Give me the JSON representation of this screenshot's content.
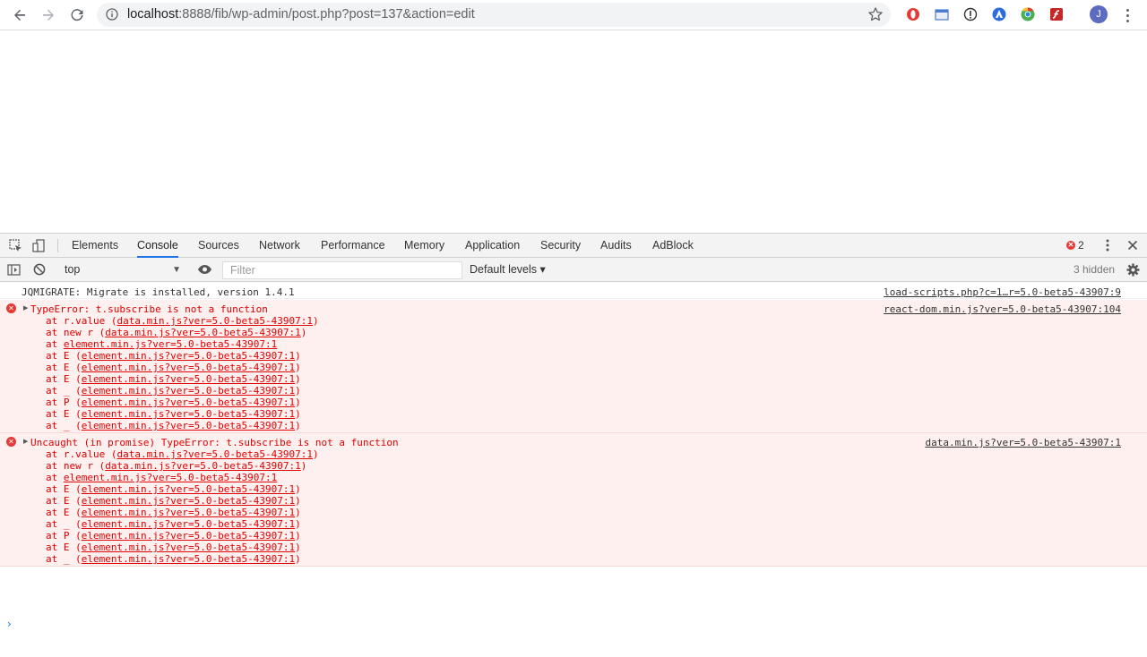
{
  "browser": {
    "url_host": "localhost",
    "url_rest": ":8888/fib/wp-admin/post.php?post=137&action=edit",
    "avatar_letter": "J",
    "extensions": [
      "opera-icon",
      "window-ext-icon",
      "info-ext-icon",
      "arrow-ext-icon",
      "chrome-ext-icon",
      "flash-ext-icon"
    ]
  },
  "devtools": {
    "tabs": [
      "Elements",
      "Console",
      "Sources",
      "Network",
      "Performance",
      "Memory",
      "Application",
      "Security",
      "Audits",
      "AdBlock"
    ],
    "active_tab": "Console",
    "error_count": "2",
    "context": "top",
    "filter_placeholder": "Filter",
    "levels_label": "Default levels ▾",
    "hidden_label": "3 hidden"
  },
  "console": {
    "info": {
      "text": "JQMIGRATE: Migrate is installed, version 1.4.1",
      "source": "load-scripts.php?c=1…r=5.0-beta5-43907:9"
    },
    "errors": [
      {
        "message": "TypeError: t.subscribe is not a function",
        "source": "react-dom.min.js?ver=5.0-beta5-43907:104",
        "frames": [
          {
            "prefix": "at r.value (",
            "link": "data.min.js?ver=5.0-beta5-43907:1",
            "suffix": ")"
          },
          {
            "prefix": "at new r (",
            "link": "data.min.js?ver=5.0-beta5-43907:1",
            "suffix": ")"
          },
          {
            "prefix": "at ",
            "link": "element.min.js?ver=5.0-beta5-43907:1",
            "suffix": ""
          },
          {
            "prefix": "at E (",
            "link": "element.min.js?ver=5.0-beta5-43907:1",
            "suffix": ")"
          },
          {
            "prefix": "at E (",
            "link": "element.min.js?ver=5.0-beta5-43907:1",
            "suffix": ")"
          },
          {
            "prefix": "at E (",
            "link": "element.min.js?ver=5.0-beta5-43907:1",
            "suffix": ")"
          },
          {
            "prefix": "at _ (",
            "link": "element.min.js?ver=5.0-beta5-43907:1",
            "suffix": ")"
          },
          {
            "prefix": "at P (",
            "link": "element.min.js?ver=5.0-beta5-43907:1",
            "suffix": ")"
          },
          {
            "prefix": "at E (",
            "link": "element.min.js?ver=5.0-beta5-43907:1",
            "suffix": ")"
          },
          {
            "prefix": "at _ (",
            "link": "element.min.js?ver=5.0-beta5-43907:1",
            "suffix": ")"
          }
        ]
      },
      {
        "message": "Uncaught (in promise) TypeError: t.subscribe is not a function",
        "source": "data.min.js?ver=5.0-beta5-43907:1",
        "frames": [
          {
            "prefix": "at r.value (",
            "link": "data.min.js?ver=5.0-beta5-43907:1",
            "suffix": ")"
          },
          {
            "prefix": "at new r (",
            "link": "data.min.js?ver=5.0-beta5-43907:1",
            "suffix": ")"
          },
          {
            "prefix": "at ",
            "link": "element.min.js?ver=5.0-beta5-43907:1",
            "suffix": ""
          },
          {
            "prefix": "at E (",
            "link": "element.min.js?ver=5.0-beta5-43907:1",
            "suffix": ")"
          },
          {
            "prefix": "at E (",
            "link": "element.min.js?ver=5.0-beta5-43907:1",
            "suffix": ")"
          },
          {
            "prefix": "at E (",
            "link": "element.min.js?ver=5.0-beta5-43907:1",
            "suffix": ")"
          },
          {
            "prefix": "at _ (",
            "link": "element.min.js?ver=5.0-beta5-43907:1",
            "suffix": ")"
          },
          {
            "prefix": "at P (",
            "link": "element.min.js?ver=5.0-beta5-43907:1",
            "suffix": ")"
          },
          {
            "prefix": "at E (",
            "link": "element.min.js?ver=5.0-beta5-43907:1",
            "suffix": ")"
          },
          {
            "prefix": "at _ (",
            "link": "element.min.js?ver=5.0-beta5-43907:1",
            "suffix": ")"
          }
        ]
      }
    ],
    "prompt_glyph": "›"
  }
}
